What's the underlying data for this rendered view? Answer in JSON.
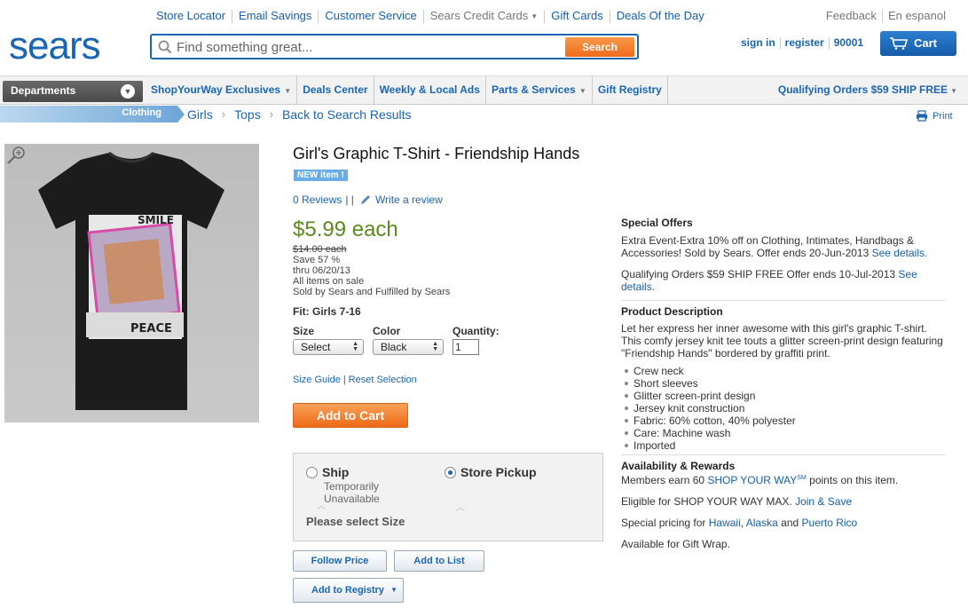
{
  "utility_links": [
    "Store Locator",
    "Email Savings",
    "Customer Service",
    "Sears Credit Cards",
    "Gift Cards",
    "Deals Of the Day"
  ],
  "utility_right": [
    "Feedback",
    "En espanol"
  ],
  "logo": "sears",
  "search": {
    "placeholder": "Find something great...",
    "button": "Search"
  },
  "account": {
    "sign_in": "sign in",
    "register": "register",
    "zip": "90001"
  },
  "cart": {
    "label": "Cart"
  },
  "nav": {
    "departments": "Departments",
    "items": [
      "ShopYourWay Exclusives",
      "Deals Center",
      "Weekly & Local Ads",
      "Parts & Services",
      "Gift Registry"
    ],
    "promo": "Qualifying Orders $59 SHIP FREE"
  },
  "breadcrumb": {
    "tab": "Clothing",
    "items": [
      "Girls",
      "Tops",
      "Back to Search Results"
    ]
  },
  "print_label": "Print",
  "product": {
    "title": "Girl's Graphic T-Shirt - Friendship Hands",
    "badge": "NEW item !",
    "reviews": "0 Reviews",
    "write_review": "Write a review",
    "price": "$5.99 each",
    "was_price": "$14.00 each",
    "save": "Save 57 %",
    "thru": "thru 06/20/13",
    "sale_note": "All items on sale",
    "sold_by": "Sold by Sears  and  Fulfilled by Sears",
    "fit": "Fit: Girls 7-16",
    "size_label": "Size",
    "size_value": "Select",
    "color_label": "Color",
    "color_value": "Black",
    "qty_label": "Quantity:",
    "qty_value": "1",
    "size_guide": "Size Guide",
    "reset": "Reset Selection",
    "add_to_cart": "Add to Cart",
    "ship_label": "Ship",
    "ship_status_1": "Temporarily",
    "ship_status_2": "Unavailable",
    "pickup_label": "Store Pickup",
    "select_size_msg": "Please select Size",
    "follow_price": "Follow Price",
    "add_to_list": "Add to List",
    "add_to_registry": "Add to Registry"
  },
  "special_offers": {
    "title": "Special Offers",
    "offer1": "Extra Event-Extra 10% off on Clothing, Intimates, Handbags & Accessories! Sold by Sears. Offer ends   20-Jun-2013",
    "offer1_link": "See details.",
    "offer2": "Qualifying Orders $59 SHIP FREE Offer ends   10-Jul-2013",
    "offer2_link": "See details."
  },
  "description": {
    "title": "Product Description",
    "text": "Let her express her inner awesome with this girl's graphic T-shirt. This comfy jersey knit tee touts a glitter screen-print design featuring \"Friendship Hands\" bordered by graffiti print.",
    "bullets": [
      "Crew neck",
      "Short sleeves",
      "Glitter screen-print design",
      "Jersey knit construction",
      "Fabric: 60% cotton, 40% polyester",
      "Care: Machine wash",
      "Imported"
    ]
  },
  "availability": {
    "title": "Availability & Rewards",
    "earn_pre": "Members earn 60",
    "earn_link": "SHOP YOUR WAY",
    "earn_sup": "SM",
    "earn_post": "points on this item.",
    "eligible": "Eligible for SHOP YOUR WAY MAX.",
    "eligible_link": "Join & Save",
    "special_pricing": "Special pricing for",
    "hawaii": "Hawaii",
    "alaska": "Alaska",
    "and": "and",
    "puerto_rico": "Puerto Rico",
    "gift_wrap": "Available for Gift Wrap."
  },
  "colors": {
    "brand_blue": "#1a66b3",
    "price_green": "#5b8a1e",
    "cta_orange": "#ee6a17"
  }
}
